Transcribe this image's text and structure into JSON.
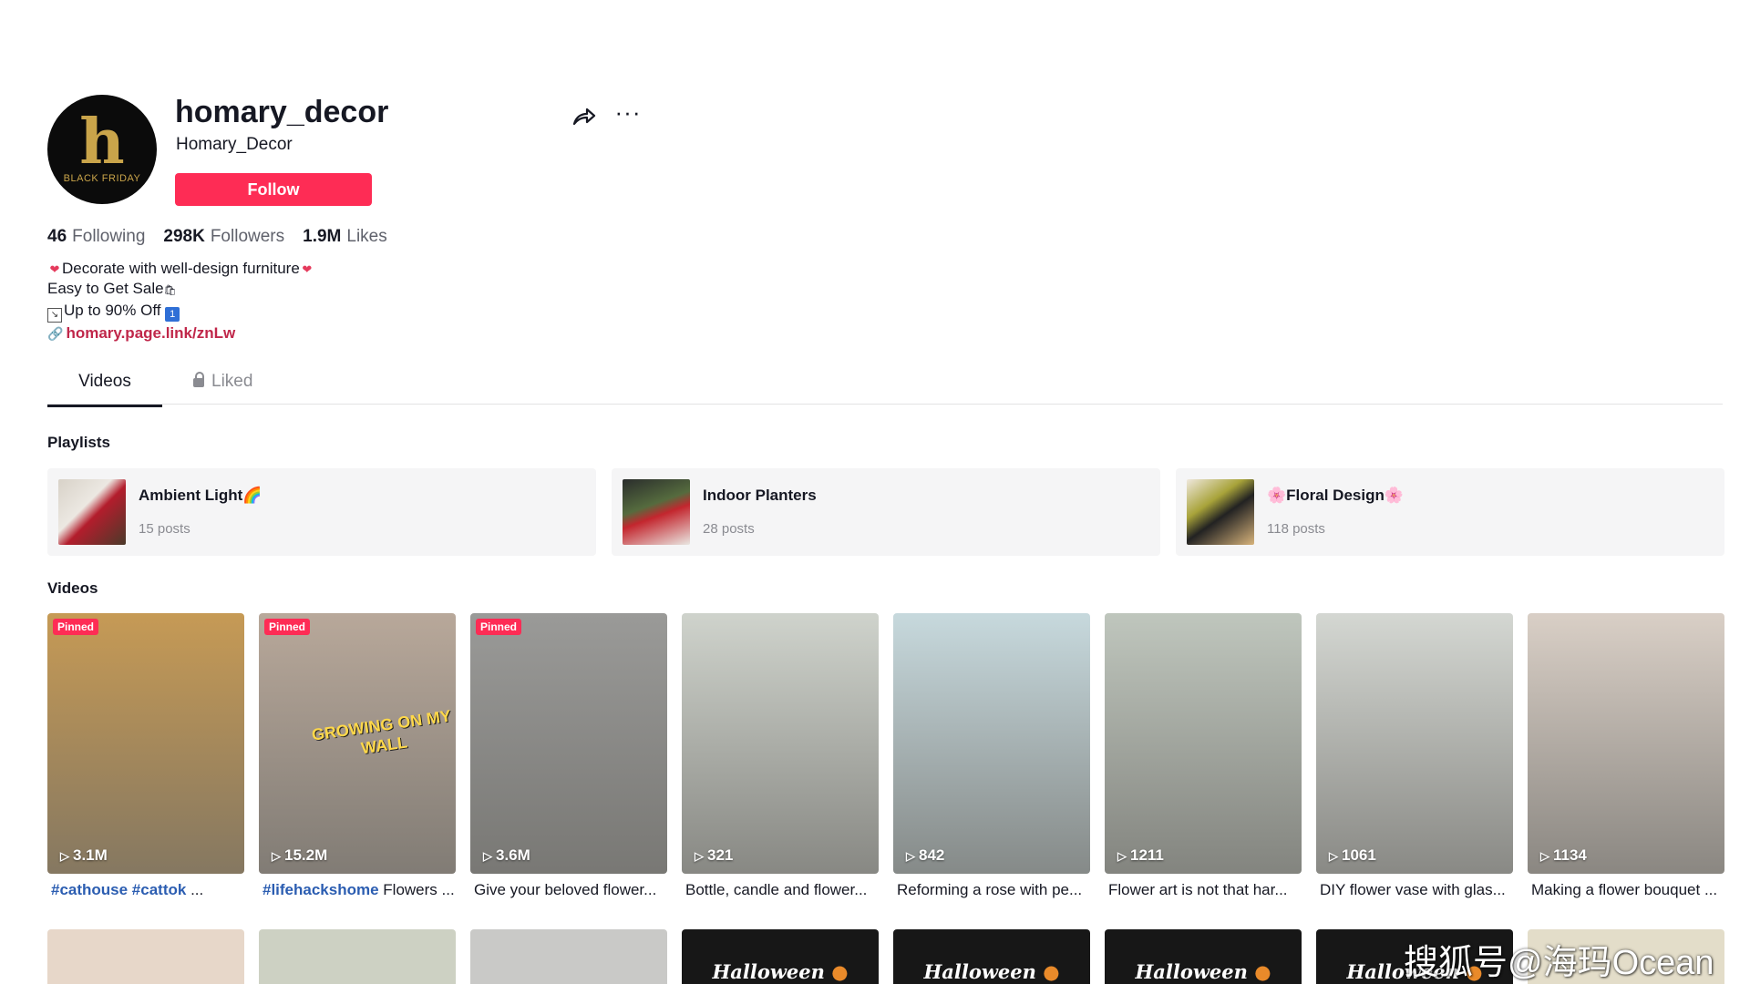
{
  "profile": {
    "username": "homary_decor",
    "nickname": "Homary_Decor",
    "avatar_caption": "BLACK FRIDAY",
    "avatar_glyph": "h",
    "follow_label": "Follow"
  },
  "icons": {
    "share": "share-icon",
    "more": "ellipsis-icon",
    "lock": "lock-icon",
    "link": "link-icon",
    "play": "play-icon"
  },
  "stats": {
    "following": {
      "value": "46",
      "label": "Following"
    },
    "followers": {
      "value": "298K",
      "label": "Followers"
    },
    "likes": {
      "value": "1.9M",
      "label": "Likes"
    }
  },
  "bio": {
    "line1": "Decorate with well-design furniture",
    "line2": "Easy to Get Sale",
    "line3": "Up to 90% Off"
  },
  "link": "homary.page.link/znLw",
  "tabs": {
    "videos": "Videos",
    "liked": "Liked"
  },
  "playlists": {
    "title": "Playlists",
    "items": [
      {
        "title": "Ambient Light🌈",
        "count": "15 posts"
      },
      {
        "title": "Indoor Planters",
        "count": "28 posts"
      },
      {
        "title": "🌸Floral Design🌸",
        "count": "118 posts"
      }
    ]
  },
  "videos": {
    "title": "Videos",
    "pinned_label": "Pinned",
    "items": [
      {
        "views": "3.1M",
        "tag": "#cathouse #cattok",
        "caption": " ...",
        "pinned": true,
        "thumb_color": "#c69a55"
      },
      {
        "views": "15.2M",
        "tag": "#lifehackshome",
        "caption": " Flowers ...",
        "pinned": true,
        "thumb_color": "#b8a89a",
        "overlay": "GROWING ON MY WALL"
      },
      {
        "views": "3.6M",
        "tag": "",
        "caption": "Give your beloved flower...",
        "pinned": true,
        "thumb_color": "#9a9a98"
      },
      {
        "views": "321",
        "tag": "",
        "caption": "Bottle, candle and flower...",
        "pinned": false,
        "thumb_color": "#cfd3cc"
      },
      {
        "views": "842",
        "tag": "",
        "caption": "Reforming a rose with pe...",
        "pinned": false,
        "thumb_color": "#c7d9dd"
      },
      {
        "views": "1211",
        "tag": "",
        "caption": "Flower art is not that har...",
        "pinned": false,
        "thumb_color": "#bfc6bd"
      },
      {
        "views": "1061",
        "tag": "",
        "caption": "DIY flower vase with glas...",
        "pinned": false,
        "thumb_color": "#d4d7d2"
      },
      {
        "views": "1134",
        "tag": "",
        "caption": "Making a flower bouquet ...",
        "pinned": false,
        "thumb_color": "#d9cfc6"
      }
    ]
  },
  "second_row": {
    "halloween_label": "Halloween",
    "items": [
      {
        "type": "photo",
        "thumb_color": "#e7d7c9"
      },
      {
        "type": "photo",
        "thumb_color": "#cdd1c3"
      },
      {
        "type": "photo",
        "thumb_color": "#c9c9c7"
      },
      {
        "type": "halloween",
        "thumb_color": "#171717"
      },
      {
        "type": "halloween",
        "thumb_color": "#171717"
      },
      {
        "type": "halloween",
        "thumb_color": "#171717"
      },
      {
        "type": "halloween",
        "thumb_color": "#171717"
      },
      {
        "type": "photo",
        "thumb_color": "#e3ddc9"
      }
    ]
  },
  "watermark": "搜狐号@海玛Ocean",
  "colors": {
    "accent": "#fe2c55",
    "link": "#c0274a",
    "hashtag": "#2b5db1",
    "text": "#161823",
    "muted": "#8a8b91"
  }
}
